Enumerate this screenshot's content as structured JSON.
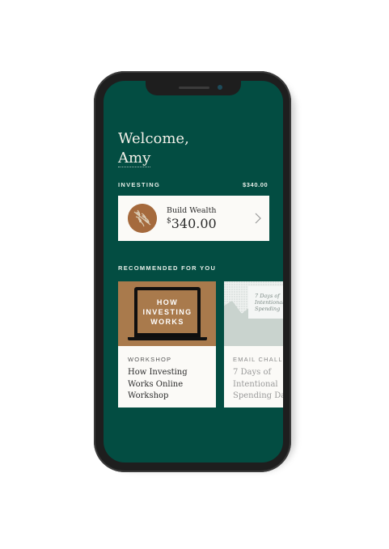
{
  "greeting": {
    "line1": "Welcome,",
    "line2": "Amy"
  },
  "investing": {
    "section_label": "INVESTING",
    "total": "$340.00",
    "card": {
      "title": "Build Wealth",
      "currency": "$",
      "amount": "340.00",
      "chevron_icon": "chevron-right-icon"
    }
  },
  "recommended": {
    "section_label": "RECOMMENDED FOR YOU",
    "items": [
      {
        "thumb_text": [
          "HOW",
          "INVESTING",
          "WORKS"
        ],
        "category": "WORKSHOP",
        "title_lines": [
          "How Investing",
          "Works Online",
          "Workshop"
        ]
      },
      {
        "thumb_text": [
          "7 Days of",
          "Intentional",
          "Spending"
        ],
        "category": "EMAIL CHALLE",
        "title_lines": [
          "7 Days of",
          "Intentional",
          "Spending Da"
        ]
      }
    ]
  },
  "colors": {
    "screen_bg": "#034d42",
    "card_bg": "#fbfaf7",
    "accent_brown": "#a97a4c"
  }
}
